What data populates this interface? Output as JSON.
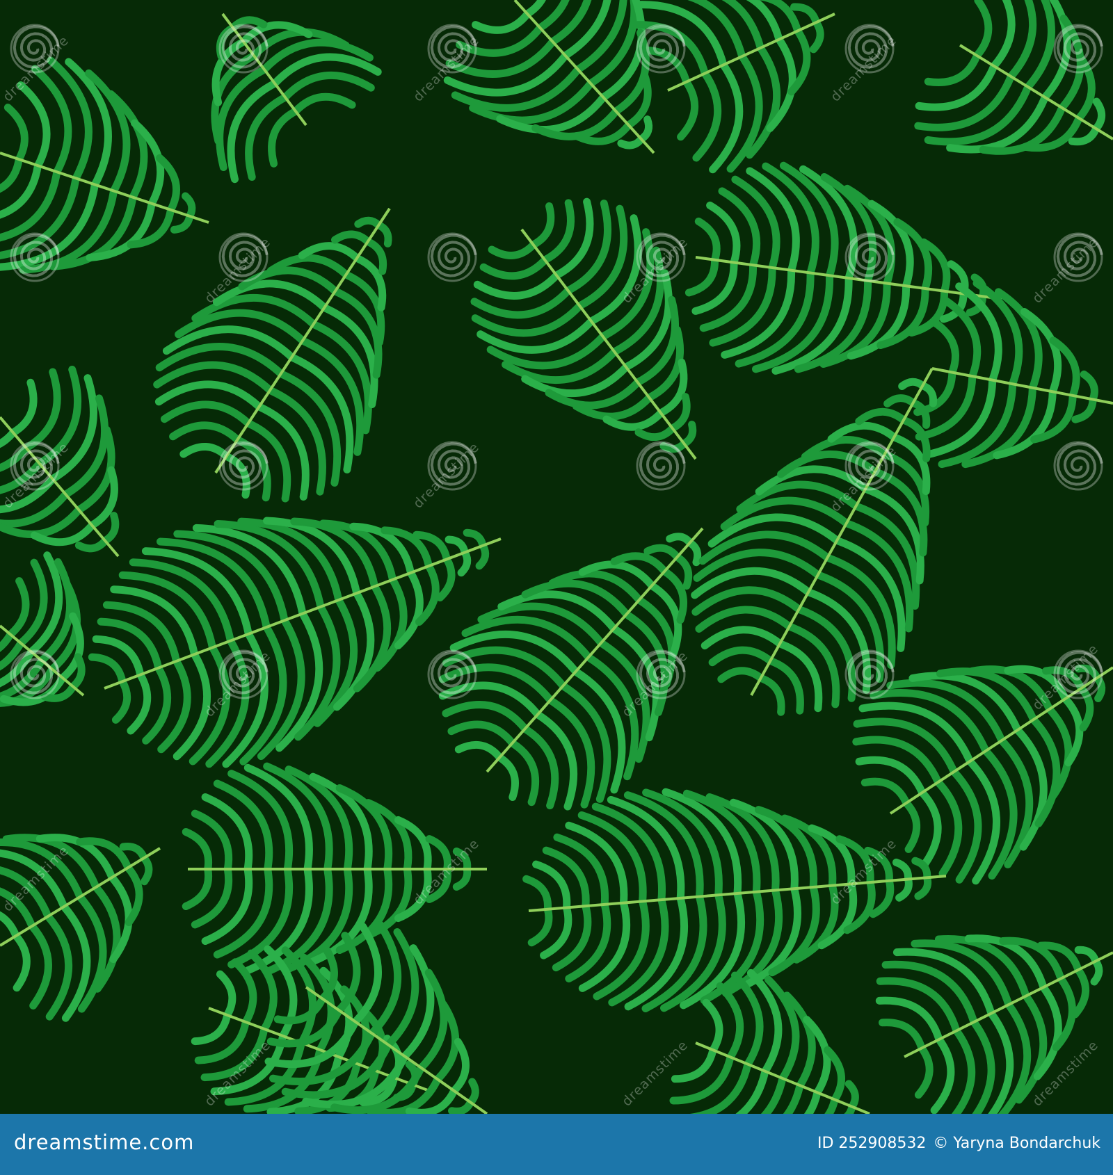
{
  "image": {
    "subject": "seamless pattern of green palm leaves",
    "colors": {
      "background": "#062a06",
      "leaf": "#1e9a3a",
      "leaf_light": "#2bb04a",
      "stem": "#8fcf5a",
      "watermark": "rgba(255,255,255,0.30)",
      "footer_bar": "#1c76aa"
    }
  },
  "watermark": {
    "text": "dreamstime",
    "icon": "spiral-icon"
  },
  "footer": {
    "logo_text": "dreamstime.com",
    "id_text": "ID 252908532",
    "copyright": "© Yaryna Bondarchuk"
  }
}
